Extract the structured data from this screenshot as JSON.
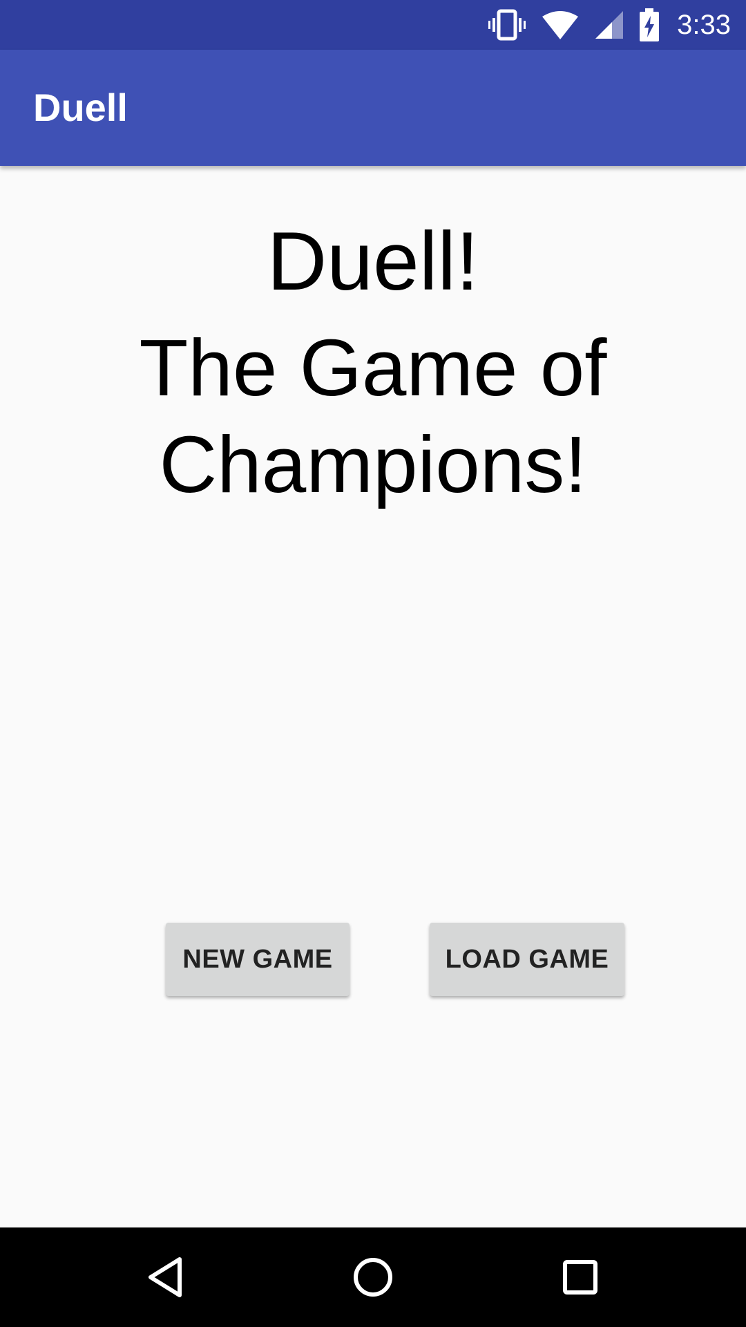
{
  "status_bar": {
    "time": "3:33",
    "icons": [
      "vibrate-icon",
      "wifi-icon",
      "cell-signal-icon",
      "battery-charging-icon"
    ],
    "background": "#303f9f"
  },
  "app_bar": {
    "title": "Duell",
    "background": "#3f51b5"
  },
  "main": {
    "heading_1": "Duell!",
    "heading_2": "The Game of Champions!"
  },
  "buttons": {
    "new_game_label": "NEW GAME",
    "load_game_label": "LOAD GAME"
  },
  "nav_bar": {
    "icons": [
      "back-icon",
      "home-icon",
      "recents-icon"
    ]
  }
}
